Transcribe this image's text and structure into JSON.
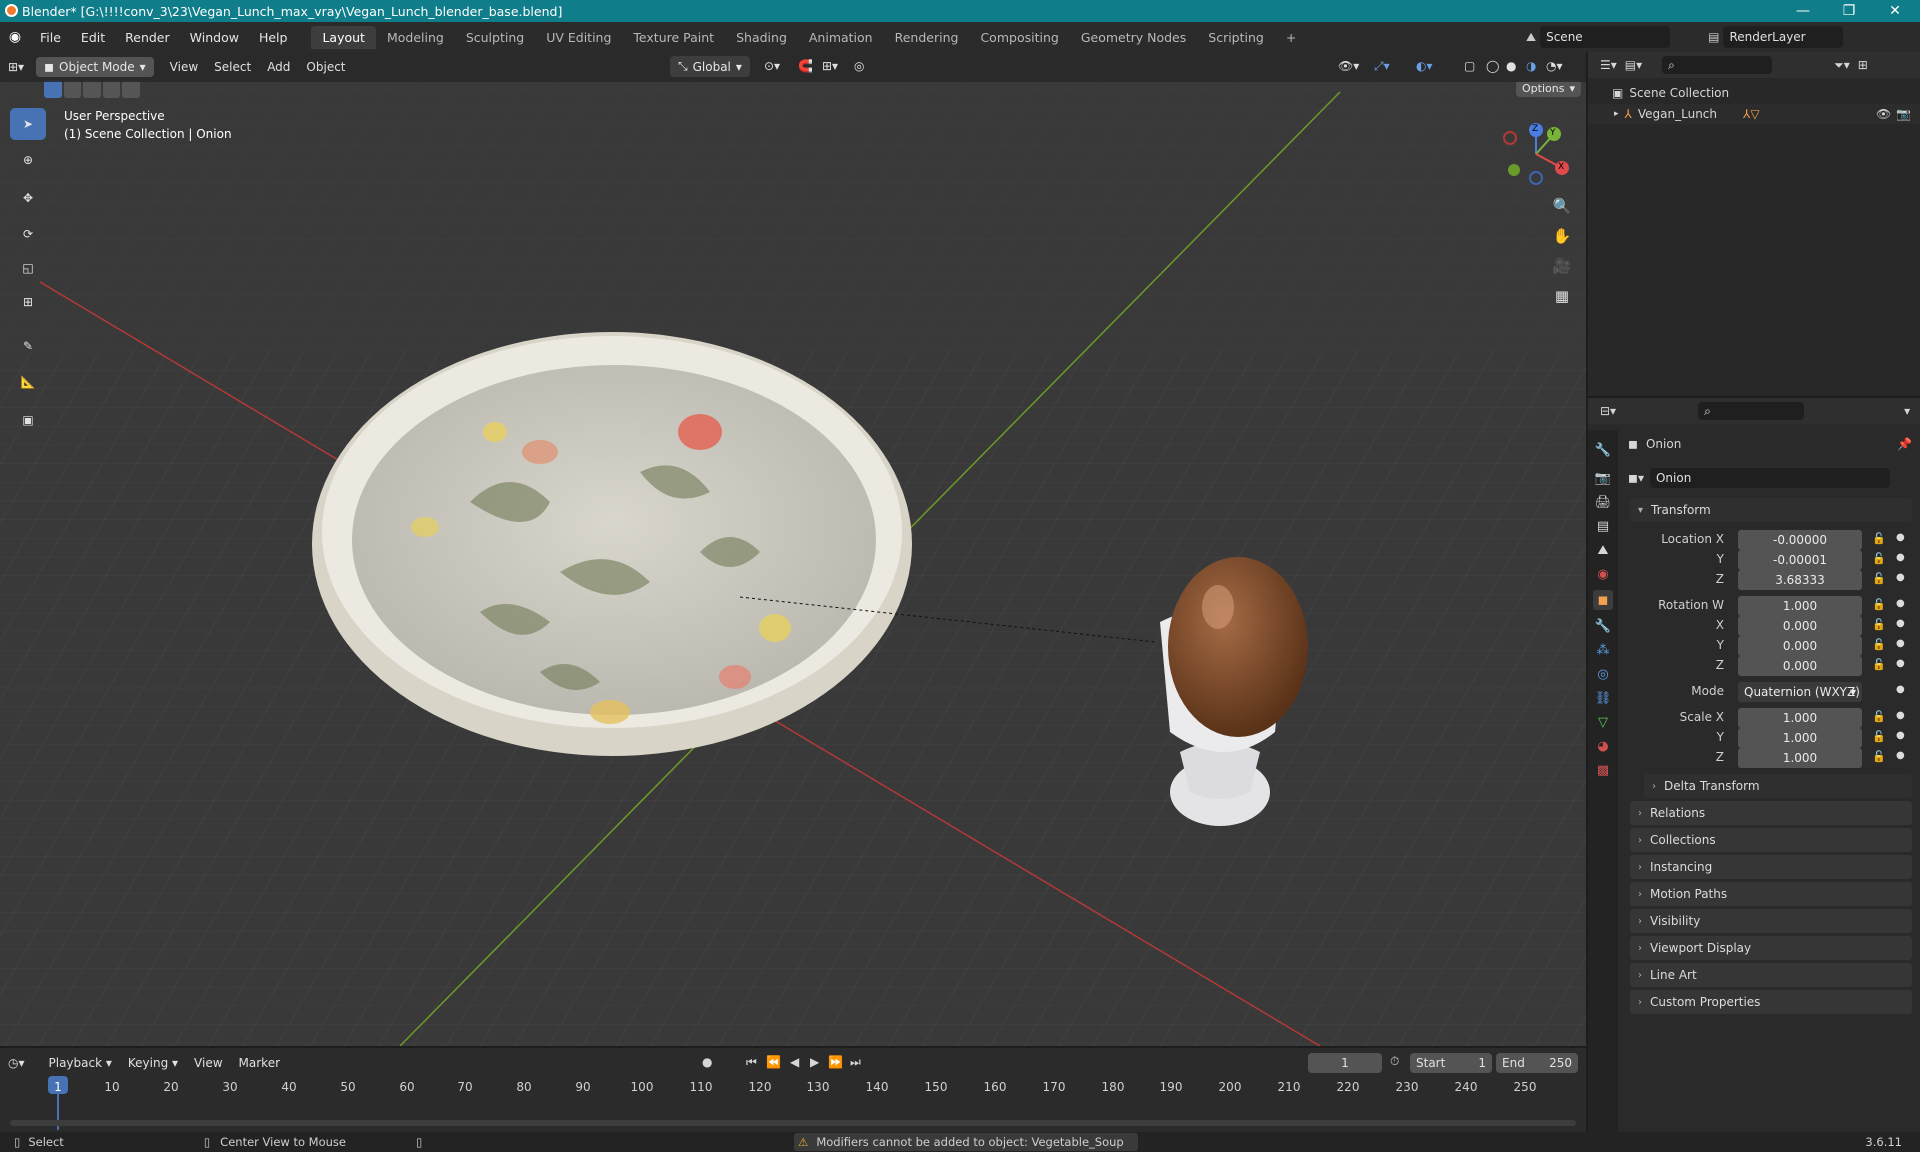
{
  "window": {
    "title": "Blender* [G:\\!!!!conv_3\\23\\Vegan_Lunch_max_vray\\Vegan_Lunch_blender_base.blend]",
    "minimize": "—",
    "maximize": "❐",
    "close": "✕"
  },
  "menu": {
    "items": [
      "File",
      "Edit",
      "Render",
      "Window",
      "Help"
    ]
  },
  "workspaces": {
    "tabs": [
      "Layout",
      "Modeling",
      "Sculpting",
      "UV Editing",
      "Texture Paint",
      "Shading",
      "Animation",
      "Rendering",
      "Compositing",
      "Geometry Nodes",
      "Scripting"
    ],
    "active": "Layout",
    "add": "+"
  },
  "scene": {
    "name": "Scene",
    "layer": "RenderLayer"
  },
  "viewport": {
    "mode": "Object Mode",
    "menus": [
      "View",
      "Select",
      "Add",
      "Object"
    ],
    "orientation": "Global",
    "options": "Options",
    "overlay_line1": "User Perspective",
    "overlay_line2": "(1) Scene Collection | Onion",
    "gizmo": {
      "z": "Z",
      "y": "Y",
      "x": "X"
    }
  },
  "outliner": {
    "root": "Scene Collection",
    "items": [
      {
        "name": "Vegan_Lunch"
      }
    ]
  },
  "properties": {
    "object_name": "Onion",
    "data_name": "Onion",
    "transform_label": "Transform",
    "location": {
      "label": "Location X",
      "x": "-0.00000",
      "y": "-0.00001",
      "z": "3.68333"
    },
    "rotation": {
      "label": "Rotation W",
      "w": "1.000",
      "x": "0.000",
      "y": "0.000",
      "z": "0.000"
    },
    "mode": {
      "label": "Mode",
      "value": "Quaternion (WXYZ)"
    },
    "scale": {
      "label": "Scale X",
      "x": "1.000",
      "y": "1.000",
      "z": "1.000"
    },
    "axis_y": "Y",
    "axis_z": "Z",
    "axis_x": "X",
    "delta": "Delta Transform",
    "panels": [
      "Relations",
      "Collections",
      "Instancing",
      "Motion Paths",
      "Visibility",
      "Viewport Display",
      "Line Art",
      "Custom Properties"
    ]
  },
  "timeline": {
    "menus": [
      "Playback",
      "Keying",
      "View",
      "Marker"
    ],
    "current_frame": "1",
    "start_label": "Start",
    "start": "1",
    "end_label": "End",
    "end": "250",
    "ticks": [
      "1",
      "10",
      "20",
      "30",
      "40",
      "50",
      "60",
      "70",
      "80",
      "90",
      "100",
      "110",
      "120",
      "130",
      "140",
      "150",
      "160",
      "170",
      "180",
      "190",
      "200",
      "210",
      "220",
      "230",
      "240",
      "250"
    ]
  },
  "status": {
    "select": "Select",
    "center": "Center View to Mouse",
    "warning": "Modifiers cannot be added to object: Vegetable_Soup",
    "version": "3.6.11"
  }
}
